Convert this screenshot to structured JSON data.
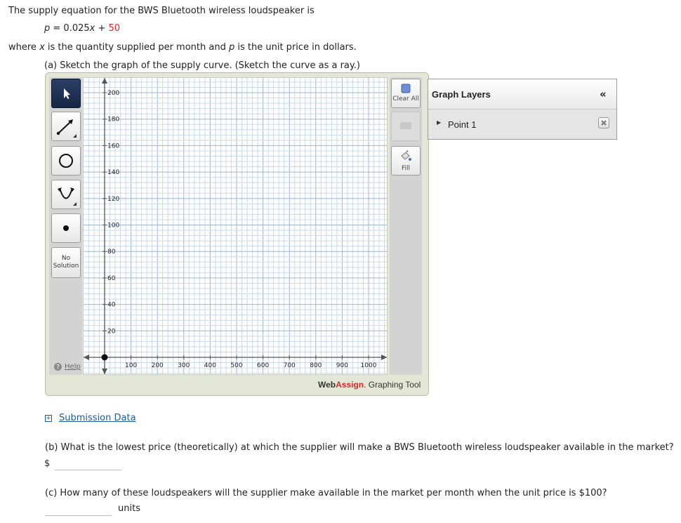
{
  "question": {
    "intro": "The supply equation for the BWS Bluetooth wireless loudspeaker is",
    "eq_var": "p",
    "eq_mid": " = 0.025",
    "eq_x": "x",
    "eq_plus": " + ",
    "eq_const": "50",
    "where_a": "where ",
    "where_x": "x",
    "where_b": " is the quantity supplied per month and ",
    "where_p": "p",
    "where_c": " is the unit price in dollars.",
    "part_a": "(a) Sketch the graph of the supply curve. (Sketch the curve as a ray.)"
  },
  "graph_tool": {
    "no_solution_1": "No",
    "no_solution_2": "Solution",
    "help": "Help",
    "clear_all": "Clear All",
    "fill": "Fill",
    "brand_web": "Web",
    "brand_assign": "Assign",
    "brand_rest": ". Graphing Tool",
    "x_ticks": [
      "100",
      "200",
      "300",
      "400",
      "500",
      "600",
      "700",
      "800",
      "900",
      "1000"
    ],
    "y_ticks": [
      "20",
      "40",
      "60",
      "80",
      "100",
      "120",
      "140",
      "160",
      "180",
      "200"
    ],
    "plotted_point": {
      "x": 0,
      "y": 0
    },
    "colors": {
      "active_tool": "#1c2d50",
      "brand_red": "#e0262b"
    }
  },
  "layers": {
    "title": "Graph Layers",
    "collapse": "«",
    "items": [
      {
        "label": "Point 1"
      }
    ]
  },
  "submission": {
    "toggle": "+",
    "label": "Submission Data"
  },
  "part_b": {
    "text": "(b) What is the lowest price (theoretically) at which the supplier will make a BWS Bluetooth wireless loudspeaker available in the market?",
    "currency": "$",
    "answer": ""
  },
  "part_c": {
    "text": "(c) How many of these loudspeakers will the supplier make available in the market per month when the unit price is $100?",
    "answer": "",
    "unit": "units"
  }
}
